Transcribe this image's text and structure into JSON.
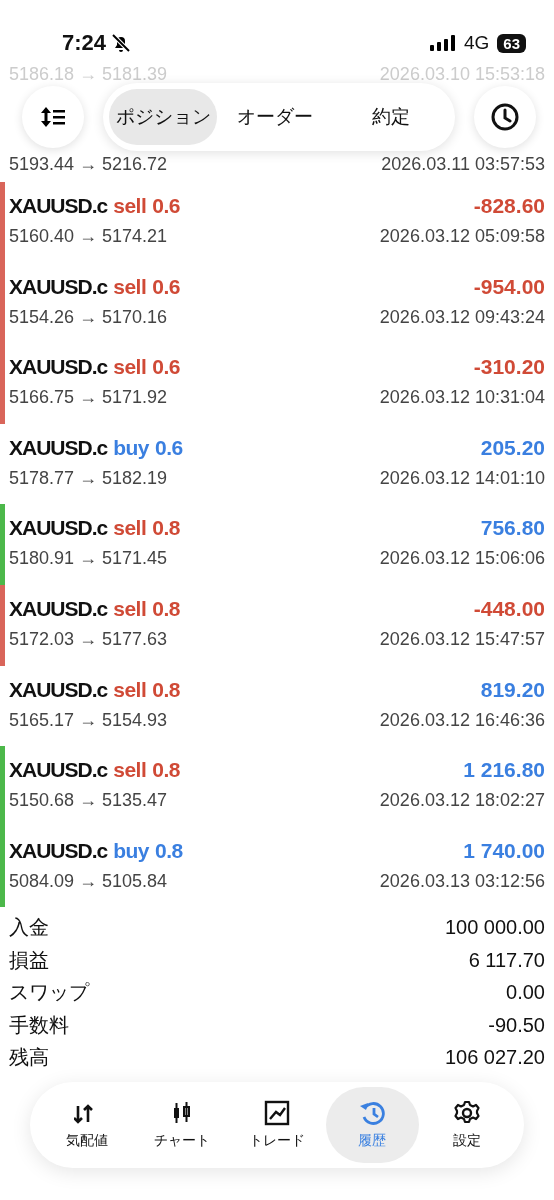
{
  "status_bar": {
    "time": "7:24",
    "network": "4G",
    "battery": "63"
  },
  "scrolled_rows": [
    {
      "prices": "5186.18 → 5181.39",
      "time": "2026.03.10 15:53:18",
      "faded": true
    },
    {
      "prices": "5193.44 → 5216.72",
      "time": "2026.03.11 03:57:53",
      "faded": false
    }
  ],
  "tabs": [
    {
      "label": "ポジション",
      "selected": true
    },
    {
      "label": "オーダー",
      "selected": false
    },
    {
      "label": "約定",
      "selected": false
    }
  ],
  "deals": [
    {
      "symbol": "XAUUSD.c",
      "side": "sell",
      "lot": "0.6",
      "profit": "-828.60",
      "prices": "5160.40 → 5174.21",
      "time": "2026.03.12 05:09:58",
      "color": "#d9655a"
    },
    {
      "symbol": "XAUUSD.c",
      "side": "sell",
      "lot": "0.6",
      "profit": "-954.00",
      "prices": "5154.26 → 5170.16",
      "time": "2026.03.12 09:43:24",
      "color": "#d9655a"
    },
    {
      "symbol": "XAUUSD.c",
      "side": "sell",
      "lot": "0.6",
      "profit": "-310.20",
      "prices": "5166.75 → 5171.92",
      "time": "2026.03.12 10:31:04",
      "color": "#d9655a"
    },
    {
      "symbol": "XAUUSD.c",
      "side": "buy",
      "lot": "0.6",
      "profit": "205.20",
      "prices": "5178.77 → 5182.19",
      "time": "2026.03.12 14:01:10"
    },
    {
      "symbol": "XAUUSD.c",
      "side": "sell",
      "lot": "0.8",
      "profit": "756.80",
      "prices": "5180.91 → 5171.45",
      "time": "2026.03.12 15:06:06",
      "color": "#4cb84a"
    },
    {
      "symbol": "XAUUSD.c",
      "side": "sell",
      "lot": "0.8",
      "profit": "-448.00",
      "prices": "5172.03 → 5177.63",
      "time": "2026.03.12 15:47:57",
      "color": "#d9655a"
    },
    {
      "symbol": "XAUUSD.c",
      "side": "sell",
      "lot": "0.8",
      "profit": "819.20",
      "prices": "5165.17 → 5154.93",
      "time": "2026.03.12 16:46:36"
    },
    {
      "symbol": "XAUUSD.c",
      "side": "sell",
      "lot": "0.8",
      "profit": "1 216.80",
      "prices": "5150.68 → 5135.47",
      "time": "2026.03.12 18:02:27",
      "color": "#4cb84a"
    },
    {
      "symbol": "XAUUSD.c",
      "side": "buy",
      "lot": "0.8",
      "profit": "1 740.00",
      "prices": "5084.09 → 5105.84",
      "time": "2026.03.13 03:12:56",
      "color": "#4cb84a"
    }
  ],
  "summary": [
    {
      "label": "入金",
      "value": "100 000.00"
    },
    {
      "label": "損益",
      "value": "6 117.70"
    },
    {
      "label": "スワップ",
      "value": "0.00"
    },
    {
      "label": "手数料",
      "value": "-90.50"
    },
    {
      "label": "残高",
      "value": "106 027.20"
    }
  ],
  "bottom_nav": [
    {
      "kind": "quotes",
      "label": "気配値",
      "selected": false
    },
    {
      "kind": "chart",
      "label": "チャート",
      "selected": false
    },
    {
      "kind": "trade",
      "label": "トレード",
      "selected": false
    },
    {
      "kind": "history",
      "label": "履歴",
      "selected": true
    },
    {
      "kind": "settings",
      "label": "設定",
      "selected": false
    }
  ]
}
